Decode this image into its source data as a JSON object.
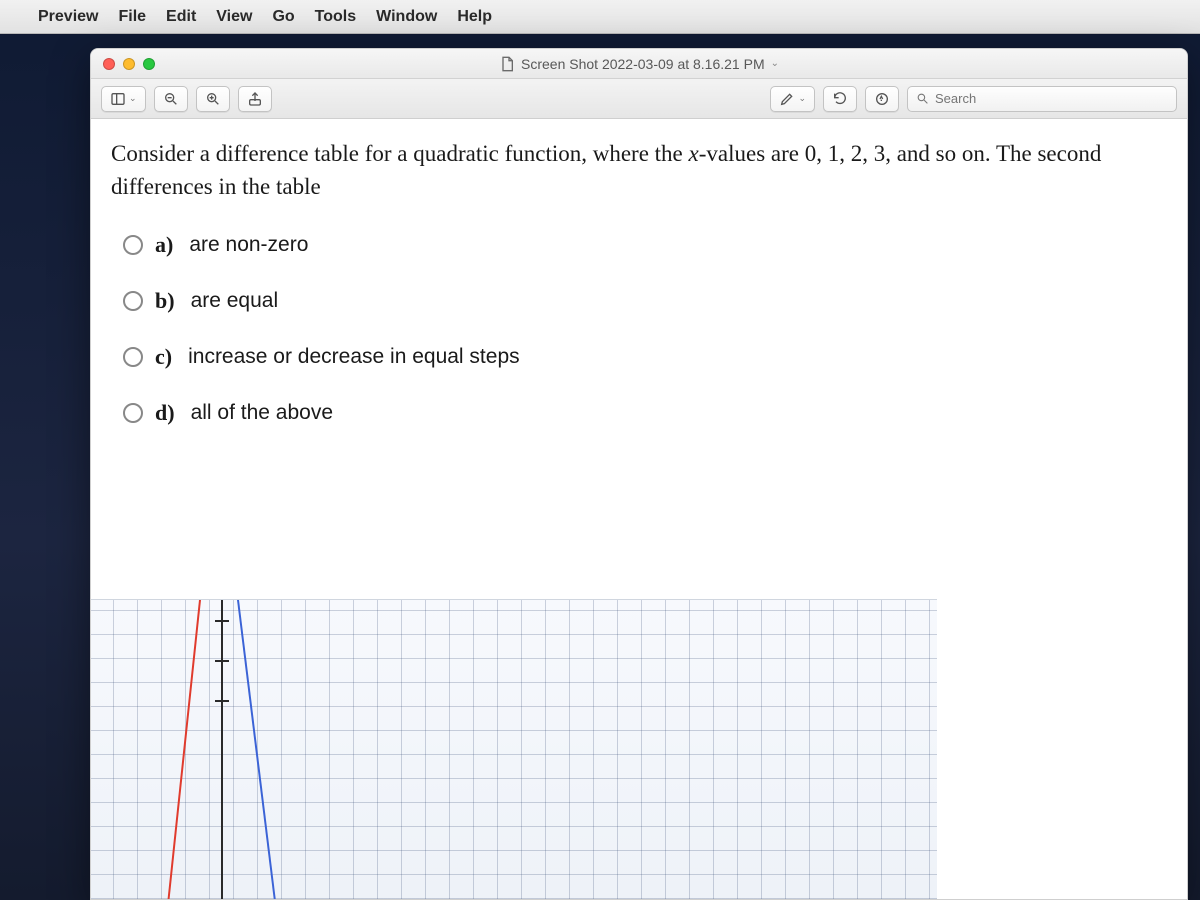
{
  "menubar": {
    "app": "Preview",
    "items": [
      "File",
      "Edit",
      "View",
      "Go",
      "Tools",
      "Window",
      "Help"
    ]
  },
  "window": {
    "title": "Screen Shot 2022-03-09 at 8.16.21 PM"
  },
  "toolbar": {
    "search_placeholder": "Search"
  },
  "question": {
    "prompt_pre": "Consider a difference table for a quadratic function, where the ",
    "prompt_x": "x",
    "prompt_post": "-values are 0, 1, 2, 3, and so on. The second differences in the table",
    "choices": [
      {
        "letter": "a)",
        "text": "are non-zero"
      },
      {
        "letter": "b)",
        "text": "are equal"
      },
      {
        "letter": "c)",
        "text": "increase or decrease in equal steps"
      },
      {
        "letter": "d)",
        "text": "all of the above"
      }
    ]
  }
}
